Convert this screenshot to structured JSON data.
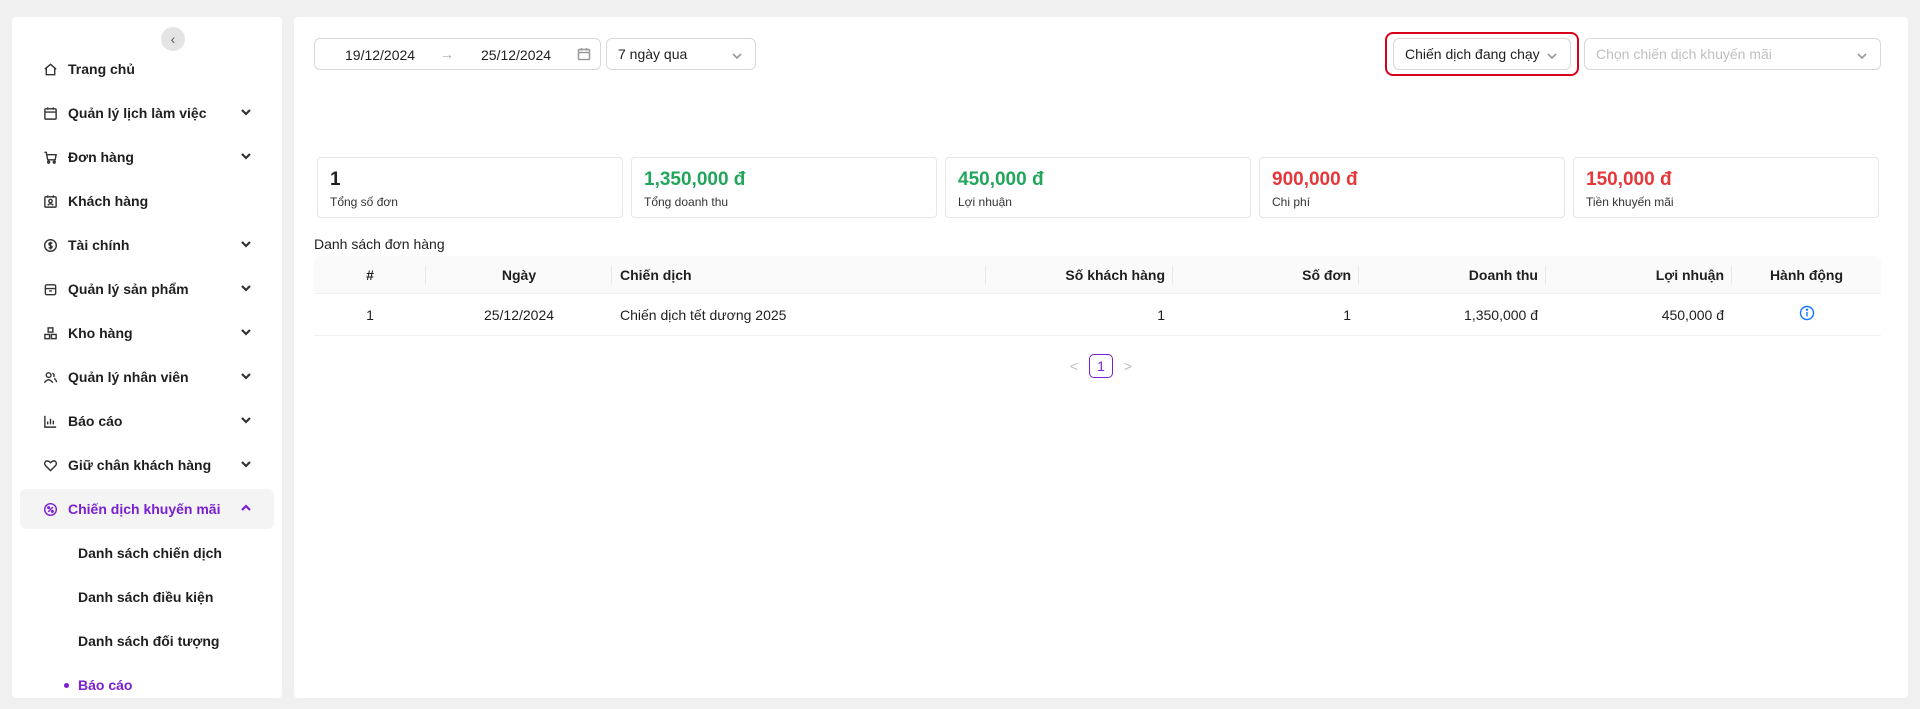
{
  "sidebar": {
    "items": [
      {
        "label": "Trang chủ",
        "icon": "home-icon",
        "has_children": false
      },
      {
        "label": "Quản lý lịch làm việc",
        "icon": "calendar-icon",
        "has_children": true
      },
      {
        "label": "Đơn hàng",
        "icon": "cart-icon",
        "has_children": true
      },
      {
        "label": "Khách hàng",
        "icon": "contact-card-icon",
        "has_children": false
      },
      {
        "label": "Tài chính",
        "icon": "dollar-circle-icon",
        "has_children": true
      },
      {
        "label": "Quản lý sản phẩm",
        "icon": "box-icon",
        "has_children": true
      },
      {
        "label": "Kho hàng",
        "icon": "warehouse-icon",
        "has_children": true
      },
      {
        "label": "Quản lý nhân viên",
        "icon": "users-icon",
        "has_children": true
      },
      {
        "label": "Báo cáo",
        "icon": "bar-chart-icon",
        "has_children": true
      },
      {
        "label": "Giữ chân khách hàng",
        "icon": "heart-icon",
        "has_children": true
      },
      {
        "label": "Chiến dịch khuyến mãi",
        "icon": "discount-icon",
        "has_children": true,
        "active": true
      }
    ],
    "subitems": [
      {
        "label": "Danh sách chiến dịch"
      },
      {
        "label": "Danh sách điều kiện"
      },
      {
        "label": "Danh sách đối tượng"
      },
      {
        "label": "Báo cáo",
        "selected": true
      }
    ]
  },
  "filters": {
    "date_start": "19/12/2024",
    "date_arrow": "→",
    "date_end": "25/12/2024",
    "period": "7 ngày qua",
    "campaign_status": "Chiến dịch đang chạy",
    "campaign_placeholder": "Chọn chiến dịch khuyến mãi"
  },
  "stats": [
    {
      "value": "1",
      "label": "Tổng số đơn",
      "color": "#1f1f1f"
    },
    {
      "value": "1,350,000 đ",
      "label": "Tổng doanh thu",
      "color": "#22a65b"
    },
    {
      "value": "450,000 đ",
      "label": "Lợi nhuận",
      "color": "#22a65b"
    },
    {
      "value": "900,000 đ",
      "label": "Chi phí",
      "color": "#e5383b"
    },
    {
      "value": "150,000 đ",
      "label": "Tiền khuyến mãi",
      "color": "#e5383b"
    }
  ],
  "table": {
    "title": "Danh sách đơn hàng",
    "headers": [
      "#",
      "Ngày",
      "Chiến dịch",
      "Số khách hàng",
      "Số đơn",
      "Doanh thu",
      "Lợi nhuận",
      "Hành động"
    ],
    "rows": [
      [
        "1",
        "25/12/2024",
        "Chiến dịch tết dương 2025",
        "1",
        "1",
        "1,350,000 đ",
        "450,000 đ"
      ]
    ]
  },
  "pagination": {
    "prev": "<",
    "current": "1",
    "next": ">"
  }
}
